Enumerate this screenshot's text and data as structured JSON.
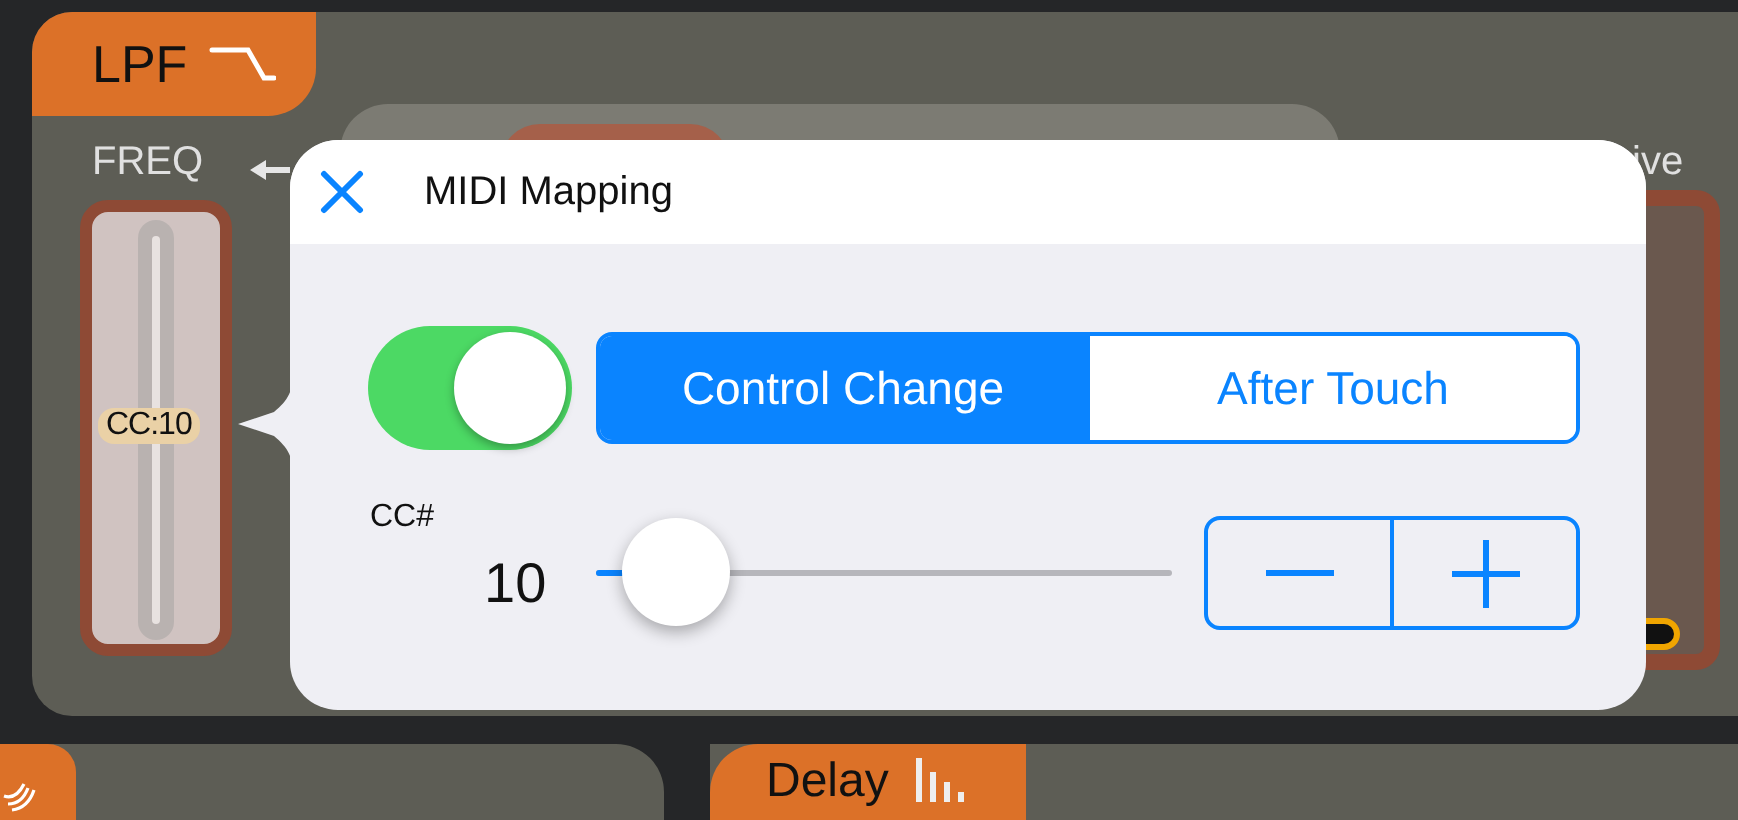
{
  "filter_tab": {
    "label": "LPF"
  },
  "freq_label": "FREQ",
  "cutoff_slider": {
    "badge": "CC:10",
    "level": 0.5
  },
  "drive_slider": {
    "level": 0.02
  },
  "drive_label": "ive",
  "midi_popover": {
    "title": "MIDI Mapping",
    "enabled": true,
    "segments": [
      {
        "label": "Control Change",
        "selected": true
      },
      {
        "label": "After Touch",
        "selected": false
      }
    ],
    "cc_label": "CC#",
    "cc_value": "10",
    "cc_slider": {
      "level": 0.14
    }
  },
  "delay_tab": {
    "label": "Delay"
  }
}
